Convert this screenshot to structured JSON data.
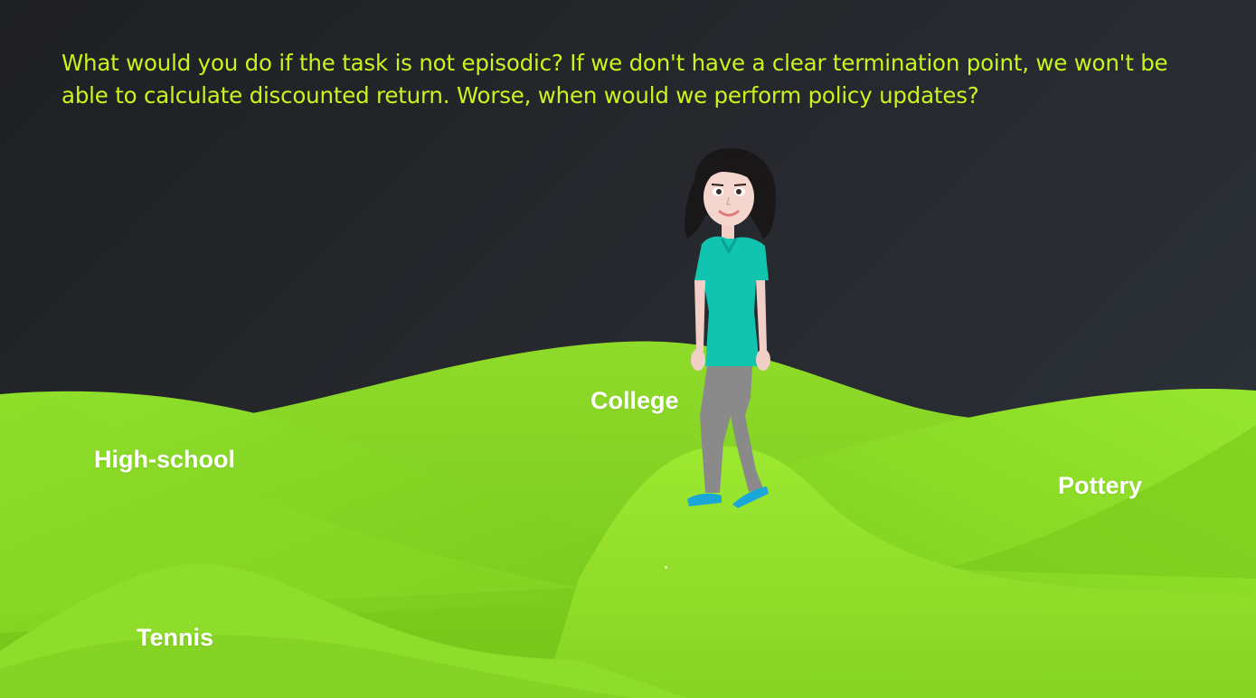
{
  "caption": {
    "text": "What would you do if the task is not episodic? If we don't have a clear termination point, we won't be able to calculate discounted return. Worse, when would we perform policy updates?"
  },
  "hills": {
    "college": "College",
    "high_school": "High-school",
    "pottery": "Pottery",
    "tennis": "Tennis"
  },
  "colors": {
    "caption": "#c8f51e",
    "background": "#222327",
    "hill_light": "#9be82f",
    "hill_mid": "#84d321",
    "hill_dark": "#6bbd12",
    "shirt": "#10c4b0",
    "pants": "#8a8a8a",
    "shoes": "#1aa7d8",
    "hair": "#1a1718",
    "skin": "#f5d6cf"
  },
  "icons": {
    "character": "woman-character-icon"
  }
}
